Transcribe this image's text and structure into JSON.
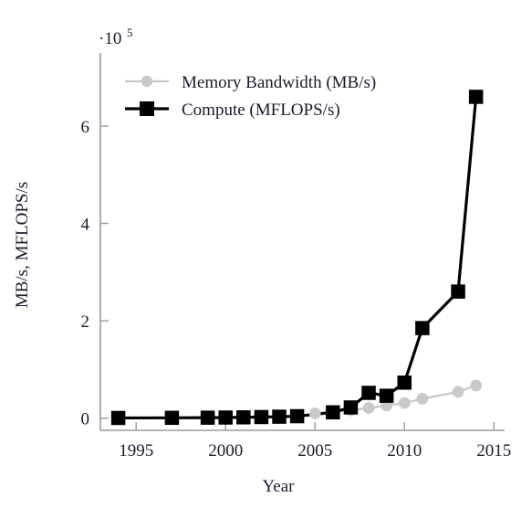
{
  "chart_data": {
    "type": "line",
    "title": "",
    "xlabel": "Year",
    "ylabel": "MB/s, MFLOPS/s",
    "y_axis_multiplier": "·10",
    "y_axis_multiplier_exponent": "5",
    "xlim": [
      1993.0,
      2015.6
    ],
    "ylim": [
      -0.25,
      7.5
    ],
    "xticks": [
      1995,
      2000,
      2005,
      2010,
      2015
    ],
    "xtick_labels": [
      "1995",
      "2000",
      "2005",
      "2010",
      "2015"
    ],
    "yticks": [
      0,
      2,
      4,
      6
    ],
    "ytick_labels": [
      "0",
      "2",
      "4",
      "6"
    ],
    "grid": false,
    "legend_position": "top-left-inside",
    "units_note": "y values are in units of 1e5",
    "series": [
      {
        "name": "Memory Bandwidth (MB/s)",
        "color": "#c9c9c9",
        "marker": "circle",
        "x": [
          2005,
          2006,
          2007,
          2008,
          2009,
          2010,
          2011,
          2013,
          2014
        ],
        "values": [
          0.1,
          0.13,
          0.16,
          0.21,
          0.26,
          0.31,
          0.4,
          0.54,
          0.67
        ]
      },
      {
        "name": "Compute (MFLOPS/s)",
        "color": "#000000",
        "marker": "square",
        "x": [
          1994,
          1997,
          1999,
          2000,
          2001,
          2002,
          2003,
          2004,
          2006,
          2007,
          2008,
          2009,
          2010,
          2011,
          2013,
          2014
        ],
        "values": [
          0.004,
          0.007,
          0.01,
          0.013,
          0.017,
          0.023,
          0.03,
          0.04,
          0.12,
          0.22,
          0.52,
          0.46,
          0.73,
          1.85,
          2.6,
          6.6
        ]
      }
    ]
  },
  "legend": {
    "entries": [
      {
        "label": "Memory Bandwidth (MB/s)",
        "color": "#c9c9c9",
        "marker": "circle"
      },
      {
        "label": "Compute (MFLOPS/s)",
        "color": "#000000",
        "marker": "square"
      }
    ]
  }
}
